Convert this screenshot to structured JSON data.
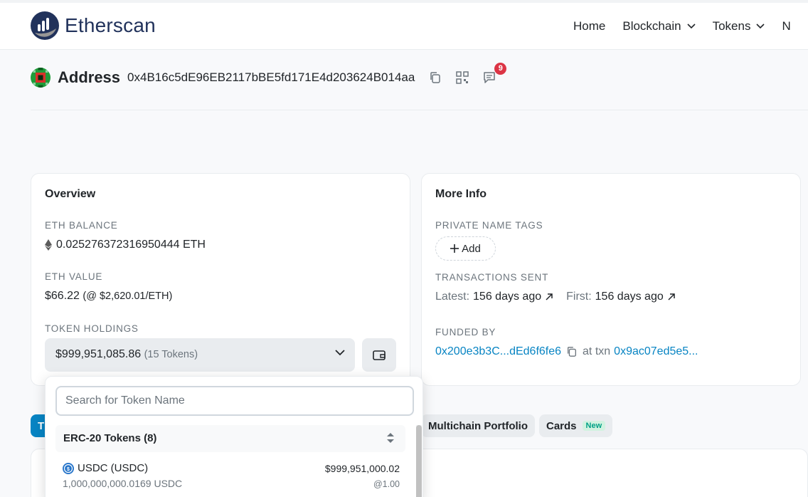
{
  "brand": {
    "name": "Etherscan"
  },
  "nav": {
    "items": [
      "Home",
      "Blockchain",
      "Tokens",
      "N"
    ]
  },
  "address": {
    "title": "Address",
    "hash": "0x4B16c5dE96EB2117bBE5fd171E4d203624B014aa",
    "notification_count": "9"
  },
  "overview": {
    "title": "Overview",
    "eth_balance_label": "ETH BALANCE",
    "eth_balance": "0.025276372316950444 ETH",
    "eth_value_label": "ETH VALUE",
    "eth_value": "$66.22",
    "eth_price": "(@ $2,620.01/ETH)",
    "token_holdings_label": "TOKEN HOLDINGS",
    "token_total": "$999,951,085.86",
    "token_count": "(15 Tokens)"
  },
  "more_info": {
    "title": "More Info",
    "private_tags_label": "PRIVATE NAME TAGS",
    "add_label": "Add",
    "tx_sent_label": "TRANSACTIONS SENT",
    "latest_label": "Latest:",
    "latest_value": "156 days ago",
    "first_label": "First:",
    "first_value": "156 days ago",
    "funded_by_label": "FUNDED BY",
    "funded_by_addr": "0x200e3b3C...dEd6f6fe6",
    "at_txn_label": "at txn",
    "funded_txn": "0x9ac07ed5e5..."
  },
  "tabs": {
    "active_fragment": "T",
    "multichain": "Multichain Portfolio",
    "cards": "Cards",
    "cards_badge": "New"
  },
  "dropdown": {
    "search_placeholder": "Search for Token Name",
    "group_label": "ERC-20 Tokens (8)",
    "tokens": [
      {
        "name": "USDC (USDC)",
        "quantity": "1,000,000,000.0169 USDC",
        "usd": "$999,951,000.02",
        "rate": "@1.00"
      }
    ]
  },
  "colors": {
    "accent": "#0784c3",
    "badge": "#dc3545",
    "brand": "#21325b"
  }
}
